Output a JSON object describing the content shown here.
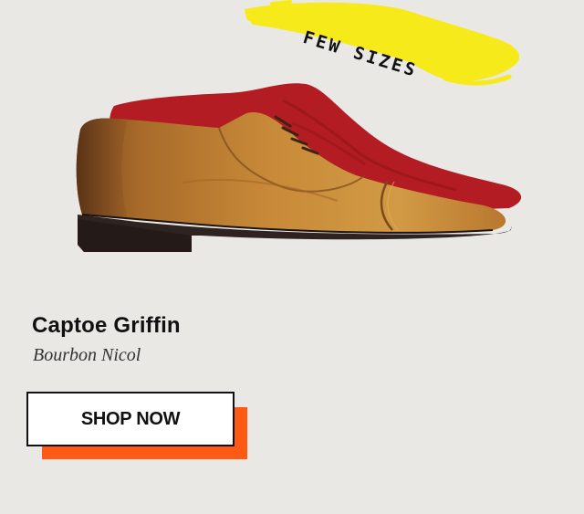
{
  "badge": {
    "text": "FEW SIZES",
    "color": "#f7ea1b"
  },
  "product": {
    "name": "Captoe Griffin",
    "variant": "Bourbon Nicol",
    "image_icon": "oxford-shoe-illustration",
    "colors": {
      "leather": "#c48734",
      "insole": "#b31c22",
      "sole": "#2e2320"
    }
  },
  "cta": {
    "label": "SHOP NOW",
    "shadow_color": "#ff5a14"
  }
}
